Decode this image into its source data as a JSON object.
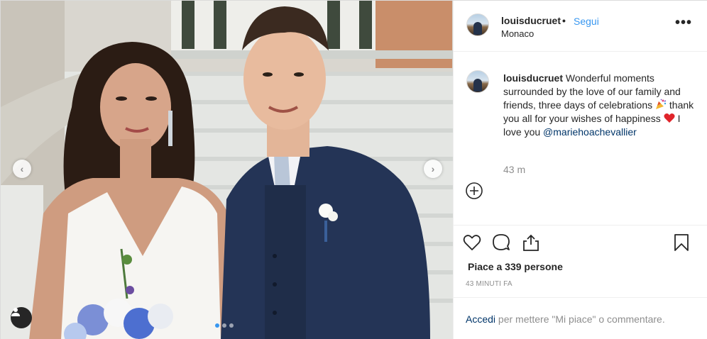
{
  "post": {
    "username": "louisducruet",
    "separator": "•",
    "follow_label": "Segui",
    "location": "Monaco",
    "more_label": "•••"
  },
  "caption": {
    "username": "louisducruet",
    "text_part1": "Wonderful moments surrounded by the love of our family and friends, three days of celebrations",
    "text_part2": "thank you all for your wishes of happiness",
    "text_part3": "I love you",
    "mention": "@mariehoachevallier",
    "time_ago": "43 m"
  },
  "engagement": {
    "likes": "Piace a 339 persone",
    "posted_time": "43 MINUTI FA"
  },
  "footer": {
    "login_link": "Accedi",
    "prompt": "per mettere \"Mi piace\" o commentare."
  },
  "carousel": {
    "prev_label": "‹",
    "next_label": "›",
    "slides_total": 3,
    "active_slide": 1
  },
  "icons": {
    "heart": "heart-icon",
    "comment": "comment-icon",
    "share": "share-icon",
    "save": "bookmark-icon",
    "add": "add-comment-icon",
    "tag": "user-tag-icon",
    "party": "party-popper-emoji",
    "love": "red-heart-emoji"
  },
  "colors": {
    "link": "#3897f0",
    "mention": "#003569",
    "muted": "#8e8e8e",
    "text": "#262626",
    "active_dot": "#3897f0"
  }
}
